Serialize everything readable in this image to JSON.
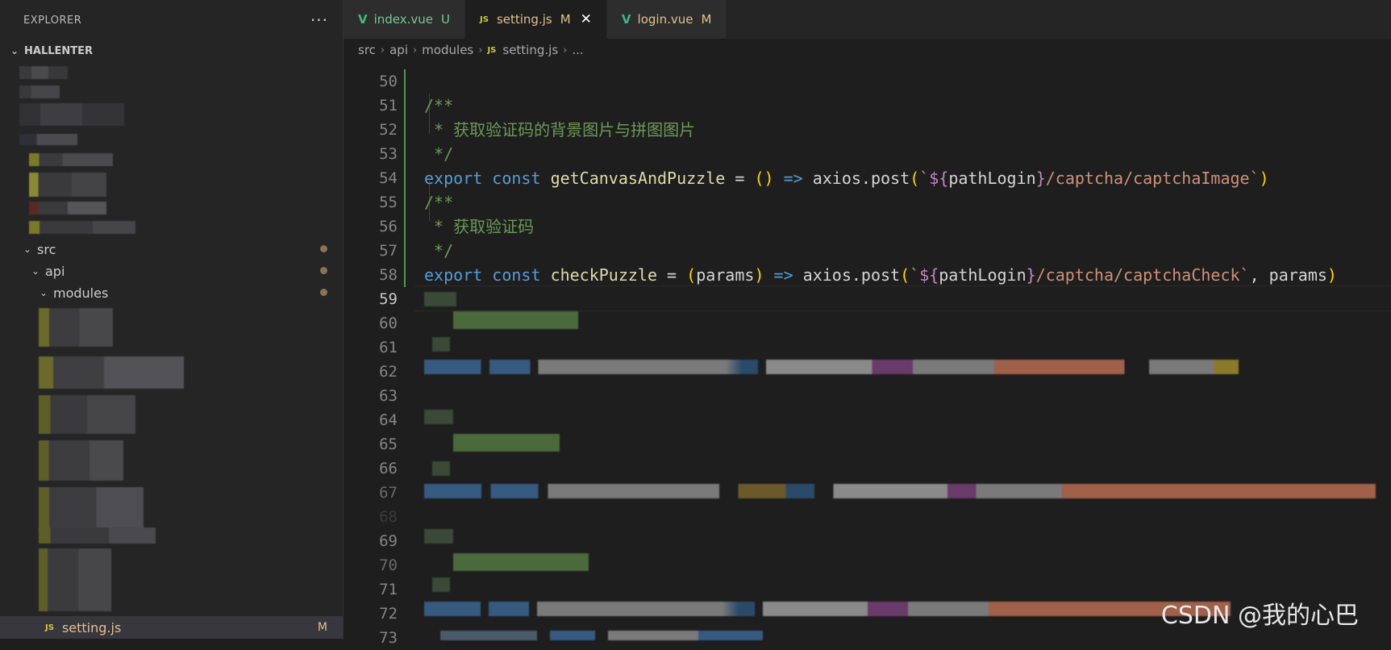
{
  "sidebar": {
    "title": "EXPLORER",
    "more_label": "···",
    "project": "HALLENTER",
    "folders": [
      {
        "label": "src",
        "modified": true
      },
      {
        "label": "api",
        "modified": true
      },
      {
        "label": "modules",
        "modified": true
      }
    ],
    "active_file": {
      "badge": "JS",
      "label": "setting.js",
      "status": "M"
    }
  },
  "tabs": [
    {
      "label": "index.vue",
      "status": "U",
      "kind": "vue"
    },
    {
      "label": "setting.js",
      "status": "M",
      "kind": "js",
      "active": true
    },
    {
      "label": "login.vue",
      "status": "M",
      "kind": "vue"
    }
  ],
  "breadcrumb": [
    "src",
    "api",
    "modules",
    "setting.js",
    "..."
  ],
  "breadcrumb_badge": "JS",
  "editor": {
    "lines": [
      {
        "n": "50"
      },
      {
        "n": "51"
      },
      {
        "n": "52"
      },
      {
        "n": "53"
      },
      {
        "n": "54"
      },
      {
        "n": "55"
      },
      {
        "n": "56"
      },
      {
        "n": "57"
      },
      {
        "n": "58"
      },
      {
        "n": "59"
      },
      {
        "n": "60"
      },
      {
        "n": "61"
      },
      {
        "n": "62"
      },
      {
        "n": "63"
      },
      {
        "n": "64"
      },
      {
        "n": "65"
      },
      {
        "n": "66"
      },
      {
        "n": "67"
      },
      {
        "n": "68"
      },
      {
        "n": "69"
      },
      {
        "n": "70"
      },
      {
        "n": "71"
      },
      {
        "n": "72"
      },
      {
        "n": "73"
      }
    ],
    "code": {
      "l50": "/**",
      "l51": " * 获取验证码的背景图片与拼图图片",
      "l52": " */",
      "l53_export": "export",
      "l53_const": "const",
      "l53_name": "getCanvasAndPuzzle",
      "l53_eq": " = ",
      "l53_parens": "()",
      "l53_arrow": " => ",
      "l53_call": "axios.post",
      "l53_open": "(",
      "l53_tick": "`",
      "l53_tmpl_open": "${",
      "l53_var": "pathLogin",
      "l53_tmpl_close": "}",
      "l53_path": "/captcha/captchaImage`",
      "l53_close": ")",
      "l54": "/**",
      "l55": " * 获取验证码",
      "l56": " */",
      "l57_export": "export",
      "l57_const": "const",
      "l57_name": "checkPuzzle",
      "l57_eq": " = ",
      "l57_open_p": "(",
      "l57_param": "params",
      "l57_close_p": ")",
      "l57_arrow": " => ",
      "l57_call": "axios.post",
      "l57_open": "(",
      "l57_tick": "`",
      "l57_tmpl_open": "${",
      "l57_var": "pathLogin",
      "l57_tmpl_close": "}",
      "l57_path": "/captcha/captchaCheck`",
      "l57_args": ", params",
      "l57_close": ")"
    }
  },
  "watermark": "CSDN @我的心巴"
}
